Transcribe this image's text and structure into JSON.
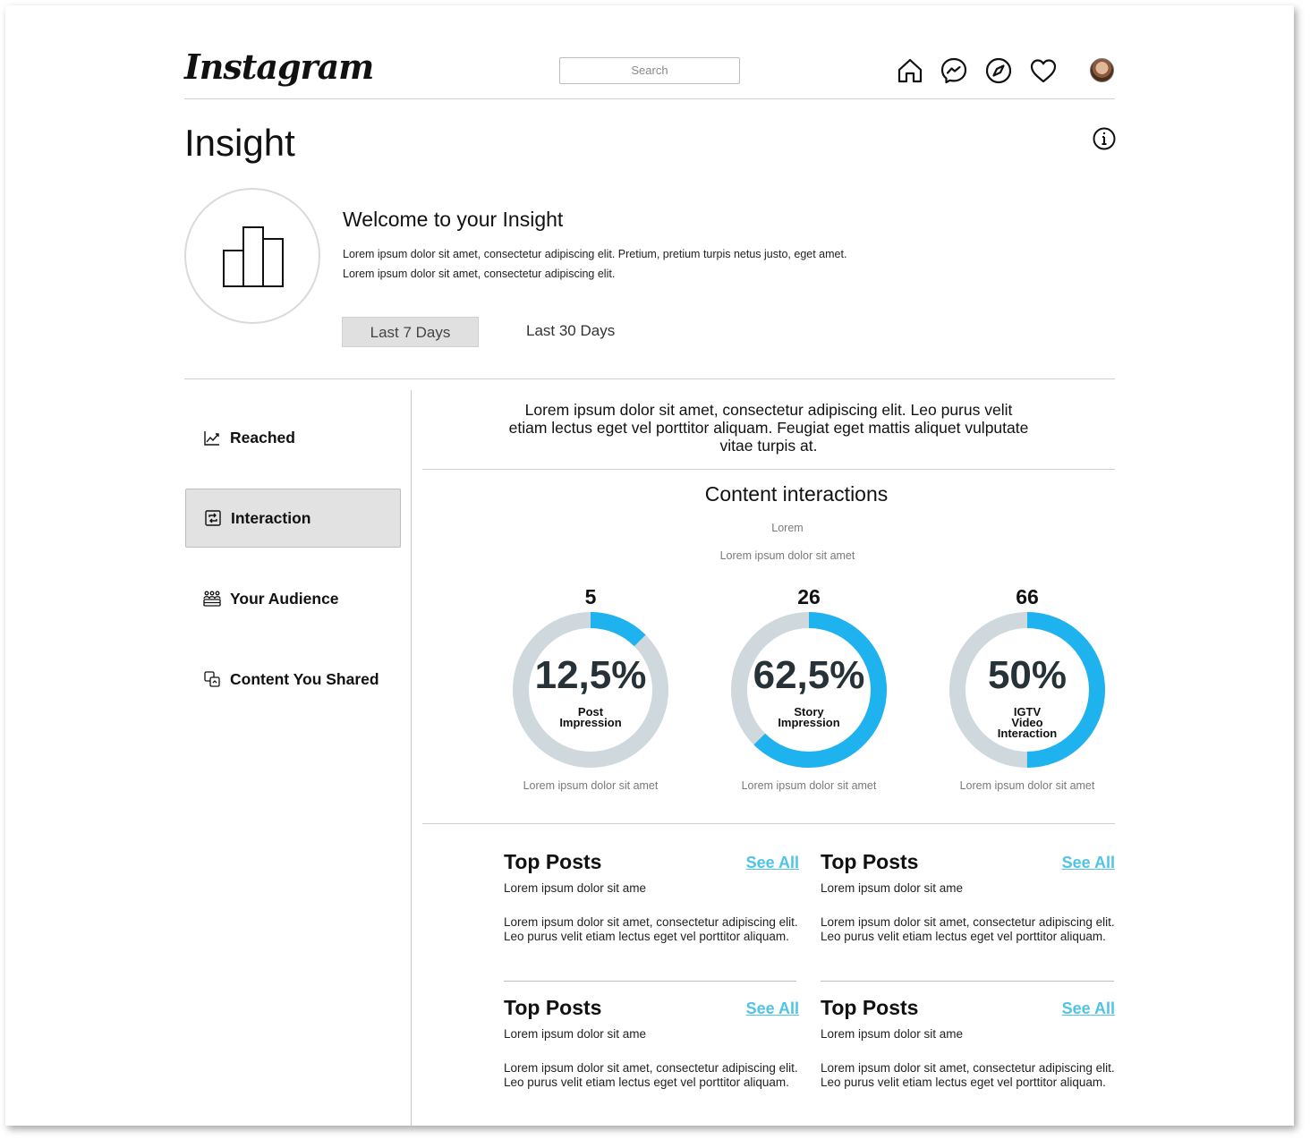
{
  "header": {
    "logo": "Instagram",
    "search_placeholder": "Search",
    "nav_icons": [
      "home-icon",
      "messenger-icon",
      "explore-compass-icon",
      "heart-icon"
    ]
  },
  "page": {
    "title": "Insight"
  },
  "welcome": {
    "heading": "Welcome to your Insight",
    "line1": "Lorem ipsum dolor sit amet, consectetur adipiscing elit. Pretium, pretium turpis netus justo, eget amet.",
    "line2": "Lorem ipsum dolor sit amet, consectetur adipiscing elit."
  },
  "range_tabs": [
    {
      "label": "Last 7 Days",
      "active": true
    },
    {
      "label": "Last 30 Days",
      "active": false
    }
  ],
  "sidebar": {
    "items": [
      {
        "label": "Reached",
        "icon": "trend-chart-icon",
        "active": false
      },
      {
        "label": "Interaction",
        "icon": "repost-icon",
        "active": true
      },
      {
        "label": "Your Audience",
        "icon": "audience-icon",
        "active": false
      },
      {
        "label": "Content You Shared",
        "icon": "shared-content-icon",
        "active": false
      }
    ]
  },
  "main": {
    "intro": "Lorem ipsum dolor sit amet, consectetur adipiscing elit. Leo purus velit etiam lectus eget vel porttitor aliquam. Feugiat eget mattis aliquet vulputate vitae turpis at.",
    "section_title": "Content interactions",
    "sub1": "Lorem",
    "sub2": "Lorem ipsum dolor sit amet"
  },
  "accent_color": "#1eb2ef",
  "track_color": "#cfd8dc",
  "donuts": [
    {
      "count": "5",
      "percent_label": "12,5%",
      "fraction": 0.125,
      "label_lines": [
        "Post",
        "Impression"
      ],
      "caption": "Lorem ipsum dolor sit amet"
    },
    {
      "count": "26",
      "percent_label": "62,5%",
      "fraction": 0.625,
      "label_lines": [
        "Story",
        "Impression"
      ],
      "caption": "Lorem ipsum dolor sit amet"
    },
    {
      "count": "66",
      "percent_label": "50%",
      "fraction": 0.5,
      "label_lines": [
        "IGTV",
        "Video",
        "Interaction"
      ],
      "caption": "Lorem ipsum dolor sit amet"
    }
  ],
  "cards": [
    {
      "title": "Top Posts",
      "link": "See All",
      "subtitle": "Lorem ipsum dolor sit ame",
      "body": "Lorem ipsum dolor sit amet, consectetur adipiscing elit. Leo purus velit etiam lectus eget vel porttitor aliquam."
    },
    {
      "title": "Top Posts",
      "link": "See All",
      "subtitle": "Lorem ipsum dolor sit ame",
      "body": "Lorem ipsum dolor sit amet, consectetur adipiscing elit. Leo purus velit etiam lectus eget vel porttitor aliquam."
    },
    {
      "title": "Top Posts",
      "link": "See All",
      "subtitle": "Lorem ipsum dolor sit ame",
      "body": "Lorem ipsum dolor sit amet, consectetur adipiscing elit. Leo purus velit etiam lectus eget vel porttitor aliquam."
    },
    {
      "title": "Top Posts",
      "link": "See All",
      "subtitle": "Lorem ipsum dolor sit ame",
      "body": "Lorem ipsum dolor sit amet, consectetur adipiscing elit. Leo purus velit etiam lectus eget vel porttitor aliquam."
    }
  ]
}
